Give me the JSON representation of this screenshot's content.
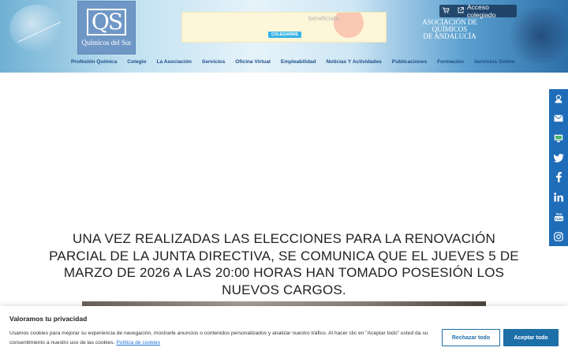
{
  "header": {
    "logo_mark": "QS",
    "logo_name": "Químicos del Sur",
    "banner_text": "beneficiate",
    "banner_button": "COLEGIARME",
    "cart_icon": "cart-icon",
    "access_icon": "external-link-icon",
    "access_label": "Acceso colegiado",
    "assoc_line1": "ASOCIACIÓN DE",
    "assoc_line2": "QUÍMICOS",
    "assoc_line3": "DE ANDALUCÍA"
  },
  "nav": {
    "items": [
      "Profesión Química",
      "Colegio",
      "La Asociación",
      "Servicios",
      "Oficina Virtual",
      "Empleabilidad",
      "Noticias Y Actividades",
      "Publicaciones",
      "Formación",
      "Servicios Online"
    ]
  },
  "social": {
    "icons": [
      "user-icon",
      "email-icon",
      "monitor-icon",
      "twitter-icon",
      "facebook-icon",
      "linkedin-icon",
      "youtube-icon",
      "instagram-icon"
    ],
    "bar_color": "#1f6db8"
  },
  "main": {
    "headline": "UNA VEZ REALIZADAS LAS ELECCIONES PARA LA RENOVACIÓN PARCIAL DE LA JUNTA DIRECTIVA, SE COMUNICA QUE EL JUEVES 5 DE MARZO DE 2026 A LAS 20:00 HORAS HAN TOMADO POSESIÓN LOS NUEVOS CARGOS."
  },
  "cookie": {
    "title": "Valoramos tu privacidad",
    "text": "Usamos cookies para mejorar su experiencia de navegación, mostrarle anuncios o contenidos personalizados y analizar nuestro tráfico. Al hacer clic en \"Aceptar todo\" usted da su consentimiento a nuestro uso de las cookies.",
    "link": "Política de cookies",
    "reject": "Rechazar todo",
    "accept": "Aceptar todo",
    "accent": "#1d6fa8"
  }
}
